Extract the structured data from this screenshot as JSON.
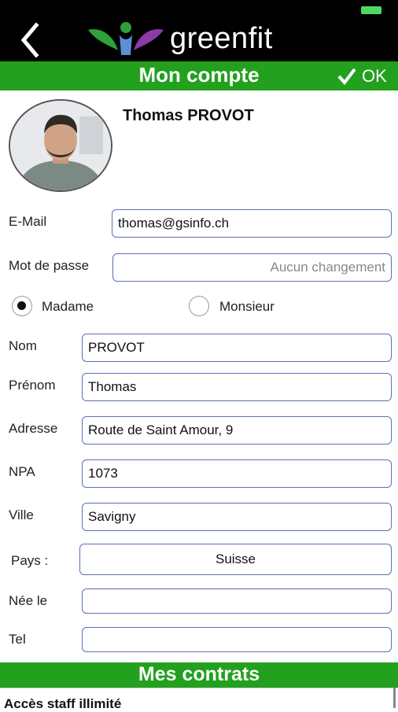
{
  "app": {
    "brand": "greenfit",
    "colors": {
      "header_bg": "#000000",
      "accent_green": "#22a01e",
      "field_border": "#5b6fb8",
      "battery": "#4cd964"
    },
    "icons": {
      "back": "chevron-left-icon",
      "ok": "checkmark-icon"
    }
  },
  "header": {
    "title": "Mon compte",
    "ok_label": "OK"
  },
  "profile": {
    "name": "Thomas PROVOT"
  },
  "form": {
    "email": {
      "label": "E-Mail",
      "value": "thomas@gsinfo.ch"
    },
    "password": {
      "label": "Mot de passe",
      "placeholder": "Aucun changement"
    },
    "gender": {
      "madame_label": "Madame",
      "monsieur_label": "Monsieur",
      "selected": "Madame"
    },
    "nom": {
      "label": "Nom",
      "value": "PROVOT"
    },
    "prenom": {
      "label": "Prénom",
      "value": "Thomas"
    },
    "adresse": {
      "label": "Adresse",
      "value": "Route de Saint Amour, 9"
    },
    "npa": {
      "label": "NPA",
      "value": "1073"
    },
    "ville": {
      "label": "Ville",
      "value": "Savigny"
    },
    "pays": {
      "label": "Pays :",
      "value": "Suisse"
    },
    "nee_le": {
      "label": "Née le",
      "value": ""
    },
    "tel": {
      "label": "Tel",
      "value": ""
    }
  },
  "contracts": {
    "title": "Mes contrats",
    "items": [
      "Accès staff illimité"
    ]
  }
}
